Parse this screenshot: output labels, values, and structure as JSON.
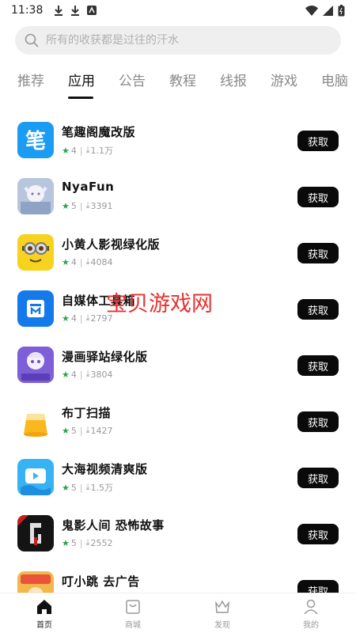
{
  "status": {
    "time": "11:38"
  },
  "search": {
    "placeholder": "所有的收获都是过往的汗水"
  },
  "tabs": [
    {
      "label": "推荐"
    },
    {
      "label": "应用"
    },
    {
      "label": "公告"
    },
    {
      "label": "教程"
    },
    {
      "label": "线报"
    },
    {
      "label": "游戏"
    },
    {
      "label": "电脑"
    }
  ],
  "active_tab": "应用",
  "apps": [
    {
      "name": "笔趣阁魔改版",
      "rating": "4",
      "downloads": "1.1万",
      "button": "获取"
    },
    {
      "name": "NyaFun",
      "rating": "5",
      "downloads": "3391",
      "button": "获取"
    },
    {
      "name": "小黄人影视绿化版",
      "rating": "4",
      "downloads": "4084",
      "button": "获取"
    },
    {
      "name": "自媒体工具箱",
      "rating": "4",
      "downloads": "2797",
      "button": "获取"
    },
    {
      "name": "漫画驿站绿化版",
      "rating": "4",
      "downloads": "3804",
      "button": "获取"
    },
    {
      "name": "布丁扫描",
      "rating": "5",
      "downloads": "1427",
      "button": "获取"
    },
    {
      "name": "大海视频清爽版",
      "rating": "5",
      "downloads": "1.5万",
      "button": "获取"
    },
    {
      "name": "鬼影人间 恐怖故事",
      "rating": "5",
      "downloads": "2552",
      "button": "获取"
    },
    {
      "name": "叮小跳 去广告",
      "rating": "",
      "downloads": "",
      "button": "获取"
    }
  ],
  "watermark": "宝贝游戏网",
  "bottom_nav": [
    {
      "label": "首页",
      "icon": "home-icon"
    },
    {
      "label": "商城",
      "icon": "shop-icon"
    },
    {
      "label": "发现",
      "icon": "crown-icon"
    },
    {
      "label": "我的",
      "icon": "person-icon"
    }
  ],
  "colors": {
    "accent": "#0a0a0a",
    "star": "#2aa24b",
    "watermark": "#e8312e"
  }
}
